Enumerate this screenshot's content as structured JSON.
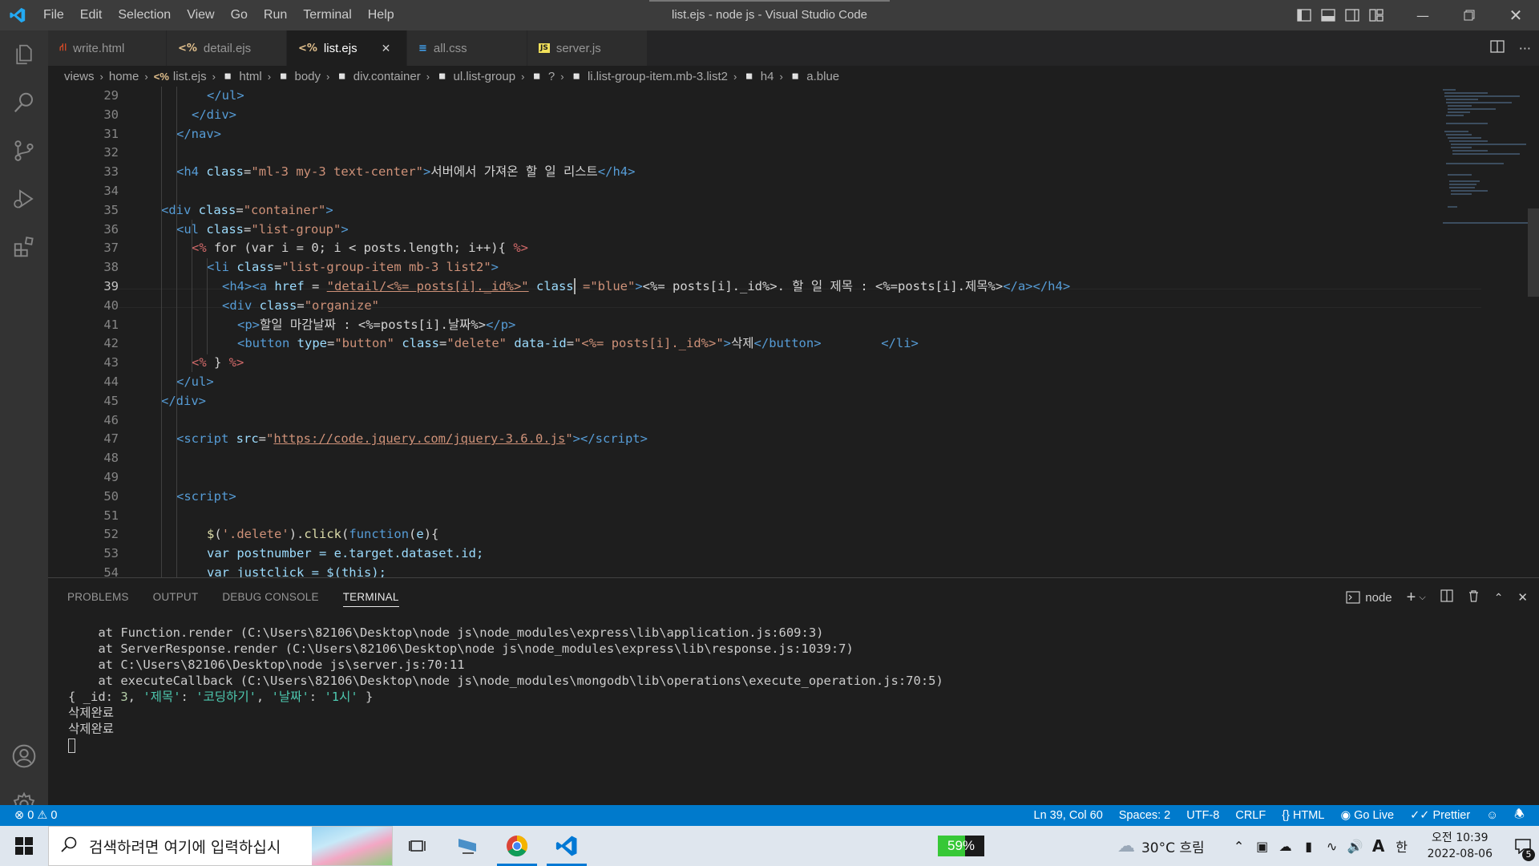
{
  "app": {
    "window_title": "list.ejs - node js - Visual Studio Code",
    "menu": [
      "File",
      "Edit",
      "Selection",
      "View",
      "Go",
      "Run",
      "Terminal",
      "Help"
    ]
  },
  "tabs": [
    {
      "label": "write.html",
      "icon": "html5-icon",
      "color": "#e44d26"
    },
    {
      "label": "detail.ejs",
      "icon": "ejs-icon",
      "color": "#e2c08d"
    },
    {
      "label": "list.ejs",
      "icon": "ejs-icon",
      "color": "#e2c08d",
      "active": true
    },
    {
      "label": "all.css",
      "icon": "css3-icon",
      "color": "#42a5f5"
    },
    {
      "label": "server.js",
      "icon": "js-icon",
      "color": "#f1e05a"
    }
  ],
  "breadcrumb": [
    "views",
    "home",
    "list.ejs",
    "html",
    "body",
    "div.container",
    "ul.list-group",
    "?",
    "li.list-group-item.mb-3.list2",
    "h4",
    "a.blue"
  ],
  "editor": {
    "current_line": 39,
    "lines": [
      {
        "n": 29,
        "indent": 5
      },
      {
        "n": 30,
        "indent": 4
      },
      {
        "n": 31,
        "indent": 3
      },
      {
        "n": 32
      },
      {
        "n": 33,
        "indent": 3
      },
      {
        "n": 34
      },
      {
        "n": 35,
        "indent": 2
      },
      {
        "n": 36,
        "indent": 3
      },
      {
        "n": 37,
        "indent": 4
      },
      {
        "n": 38,
        "indent": 5
      },
      {
        "n": 39,
        "indent": 6
      },
      {
        "n": 40,
        "indent": 6
      },
      {
        "n": 41,
        "indent": 7
      },
      {
        "n": 42,
        "indent": 7
      },
      {
        "n": 43,
        "indent": 4
      },
      {
        "n": 44,
        "indent": 3
      },
      {
        "n": 45,
        "indent": 2
      },
      {
        "n": 46
      },
      {
        "n": 47,
        "indent": 3
      },
      {
        "n": 48
      },
      {
        "n": 49
      },
      {
        "n": 50,
        "indent": 3
      },
      {
        "n": 51
      },
      {
        "n": 52,
        "indent": 5
      },
      {
        "n": 53,
        "indent": 5
      },
      {
        "n": 54,
        "indent": 5
      }
    ],
    "code": {
      "l29": "</ul>",
      "l30": "</div>",
      "l31": "</nav>",
      "l33_text": "서버에서 가져온 할 일 리스트",
      "l35_class": "\"container\"",
      "l36_class": "\"list-group\"",
      "l37": "for (var i = 0; i < posts.length; i++){",
      "l38_class": "\"list-group-item mb-3 list2\"",
      "l39_href": "\"detail/<%= posts[i]._id%>\"",
      "l39_class": "=\"blue\"",
      "l39_text": "<%= posts[i]._id%>. 할 일 제목 : <%=posts[i].제목%>",
      "l40_class": "\"organize\"",
      "l41_text": "할일 마감날짜 : <%=posts[i].날짜%>",
      "l42_type": "\"button\"",
      "l42_class": "\"delete\"",
      "l42_dataid": "\"<%= posts[i]._id%>\"",
      "l42_text": "삭제",
      "l47_src": "https://code.jquery.com/jquery-3.6.0.js",
      "l52_sel": "'.delete'",
      "l53": "var postnumber = e.target.dataset.id;",
      "l54": "var justclick = $(this);"
    }
  },
  "panel": {
    "tabs": [
      "PROBLEMS",
      "OUTPUT",
      "DEBUG CONSOLE",
      "TERMINAL"
    ],
    "active_tab": "TERMINAL",
    "terminal_name": "node",
    "terminal_lines": [
      "    at Function.render (C:\\Users\\82106\\Desktop\\node js\\node_modules\\express\\lib\\application.js:609:3)",
      "    at ServerResponse.render (C:\\Users\\82106\\Desktop\\node js\\node_modules\\express\\lib\\response.js:1039:7)",
      "    at C:\\Users\\82106\\Desktop\\node js\\server.js:70:11",
      "    at executeCallback (C:\\Users\\82106\\Desktop\\node js\\node_modules\\mongodb\\lib\\operations\\execute_operation.js:70:5)"
    ],
    "terminal_obj": {
      "id": "3",
      "title_key": "'제목'",
      "title_val": "'코딩하기'",
      "date_key": "'날짜'",
      "date_val": "'1시'"
    },
    "terminal_tail": [
      "삭제완료",
      "삭제완료"
    ]
  },
  "statusbar": {
    "errors": "0",
    "warnings": "0",
    "position": "Ln 39, Col 60",
    "spaces": "Spaces: 2",
    "encoding": "UTF-8",
    "eol": "CRLF",
    "language": "HTML",
    "golive": "Go Live",
    "prettier": "Prettier"
  },
  "taskbar": {
    "search_placeholder": "검색하려면 여기에 입력하십시",
    "battery": "59%",
    "battery_level": 0.59,
    "weather": "30°C 흐림",
    "ime": "한",
    "time": "오전 10:39",
    "date": "2022-08-06",
    "notifications": "5",
    "accent_color": "#0078d4"
  },
  "colors": {
    "statusbar": "#007acc",
    "titlebar": "#3c3c3c",
    "editor_bg": "#1e1e1e"
  }
}
